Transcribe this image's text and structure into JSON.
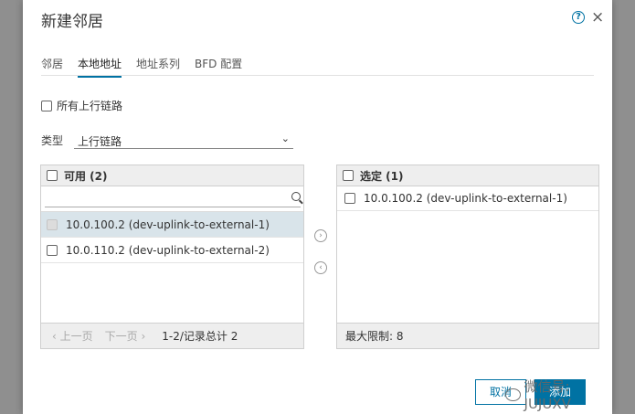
{
  "dialog": {
    "title": "新建邻居",
    "help_icon": "?",
    "close_icon": "×"
  },
  "tabs": [
    {
      "label": "邻居",
      "active": false
    },
    {
      "label": "本地地址",
      "active": true
    },
    {
      "label": "地址系列",
      "active": false
    },
    {
      "label": "BFD 配置",
      "active": false
    }
  ],
  "all_uplinks": {
    "label": "所有上行链路",
    "checked": false
  },
  "type": {
    "label": "类型",
    "value": "上行链路",
    "chevron": "⌄"
  },
  "available": {
    "header": "可用 (2)",
    "search_placeholder": "",
    "rows": [
      {
        "label": "10.0.100.2 (dev-uplink-to-external-1)",
        "selected": true
      },
      {
        "label": "10.0.110.2 (dev-uplink-to-external-2)",
        "selected": false
      }
    ],
    "footer": {
      "prev": "‹ 上一页",
      "next": "下一页 ›",
      "count": "1-2/记录总计 2"
    }
  },
  "selected": {
    "header": "选定 (1)",
    "rows": [
      {
        "label": "10.0.100.2 (dev-uplink-to-external-1)"
      }
    ],
    "footer": "最大限制: 8"
  },
  "move_right_icon": "›",
  "move_left_icon": "‹",
  "buttons": {
    "cancel": "取消",
    "add": "添加"
  },
  "watermark": "微信号: JUJUXV",
  "colors": {
    "accent": "#0072a3",
    "selected_row": "#d9e4ea",
    "panel_header": "#eeeeee"
  }
}
